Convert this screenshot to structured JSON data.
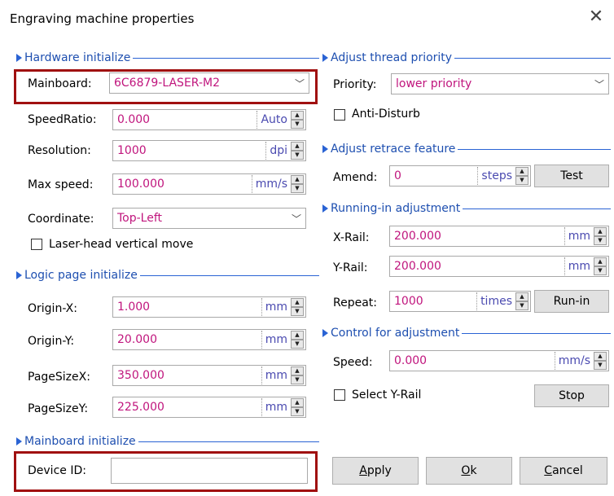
{
  "window": {
    "title": "Engraving machine properties"
  },
  "sections": {
    "hardware": "Hardware initialize",
    "logic": "Logic page initialize",
    "mainboard": "Mainboard initialize",
    "thread": "Adjust thread priority",
    "retrace": "Adjust retrace feature",
    "running": "Running-in adjustment",
    "control": "Control for adjustment"
  },
  "hardware": {
    "mainboard_label": "Mainboard:",
    "mainboard_value": "6C6879-LASER-M2",
    "speedratio_label": "SpeedRatio:",
    "speedratio_value": "0.000",
    "speedratio_unit": "Auto",
    "resolution_label": "Resolution:",
    "resolution_value": "1000",
    "resolution_unit": "dpi",
    "maxspeed_label": "Max speed:",
    "maxspeed_value": "100.000",
    "maxspeed_unit": "mm/s",
    "coordinate_label": "Coordinate:",
    "coordinate_value": "Top-Left",
    "laser_vertical_label": "Laser-head vertical move"
  },
  "logic": {
    "originx_label": "Origin-X:",
    "originx_value": "1.000",
    "originx_unit": "mm",
    "originy_label": "Origin-Y:",
    "originy_value": "20.000",
    "originy_unit": "mm",
    "pagesizex_label": "PageSizeX:",
    "pagesizex_value": "350.000",
    "pagesizex_unit": "mm",
    "pagesizey_label": "PageSizeY:",
    "pagesizey_value": "225.000",
    "pagesizey_unit": "mm"
  },
  "mainboard_init": {
    "deviceid_label": "Device ID:",
    "deviceid_value": ""
  },
  "thread": {
    "priority_label": "Priority:",
    "priority_value": "lower priority",
    "anti_disturb_label": "Anti-Disturb"
  },
  "retrace": {
    "amend_label": "Amend:",
    "amend_value": "0",
    "amend_unit": "steps",
    "test_button": "Test"
  },
  "running": {
    "xrail_label": "X-Rail:",
    "xrail_value": "200.000",
    "xrail_unit": "mm",
    "yrail_label": "Y-Rail:",
    "yrail_value": "200.000",
    "yrail_unit": "mm",
    "repeat_label": "Repeat:",
    "repeat_value": "1000",
    "repeat_unit": "times",
    "runin_button": "Run-in"
  },
  "control": {
    "speed_label": "Speed:",
    "speed_value": "0.000",
    "speed_unit": "mm/s",
    "select_yrail_label": "Select Y-Rail",
    "stop_button": "Stop"
  },
  "buttons": {
    "apply_first": "A",
    "apply_rest": "pply",
    "ok_first": "O",
    "ok_rest": "k",
    "cancel_first": "C",
    "cancel_rest": "ancel"
  },
  "colors": {
    "value_text": "#c0157d",
    "section_blue": "#1e4fb0",
    "highlight_red": "#a01010"
  }
}
